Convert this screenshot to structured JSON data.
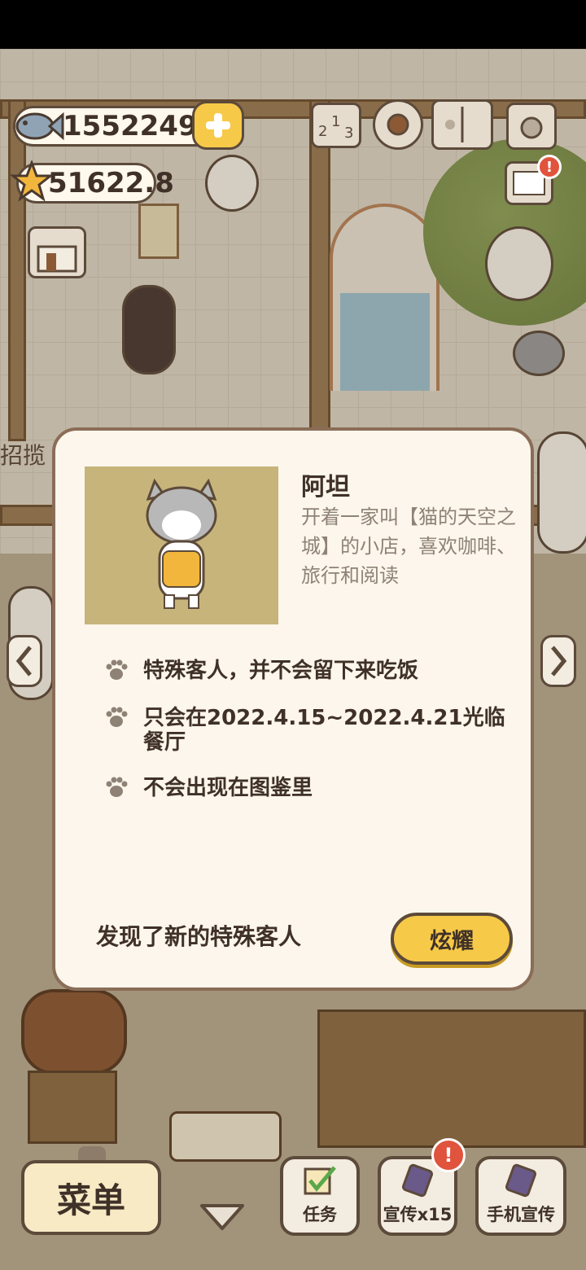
{
  "hud": {
    "fish_count": "1552249",
    "star_count": "51622.8",
    "ticker_partial": "招揽"
  },
  "icons": {
    "fish": "fish-icon",
    "star": "star-icon",
    "plus": "plus-icon",
    "ranking": "ranking-icon",
    "settings": "gear-icon",
    "book": "book-icon",
    "camera": "camera-icon",
    "mail": "mail-icon",
    "shop": "shop-icon",
    "alert": "!"
  },
  "modal": {
    "character_name": "阿坦",
    "character_description": "开着一家叫【猫的天空之城】的小店，喜欢咖啡、旅行和阅读",
    "bullets": [
      "特殊客人，并不会留下来吃饭",
      "只会在2022.4.15~2022.4.21光临餐厅",
      "不会出现在图鉴里"
    ],
    "footer_text": "发现了新的特殊客人",
    "show_off_button": "炫耀"
  },
  "bottom": {
    "menu_label": "菜单",
    "tasks_label": "任务",
    "promote_label": "宣传x15",
    "phone_promote_label": "手机宣传"
  },
  "colors": {
    "accent_yellow": "#f7c948",
    "outline_brown": "#5c4a3a",
    "modal_bg": "#fdf6ec",
    "alert_red": "#e0533c"
  }
}
